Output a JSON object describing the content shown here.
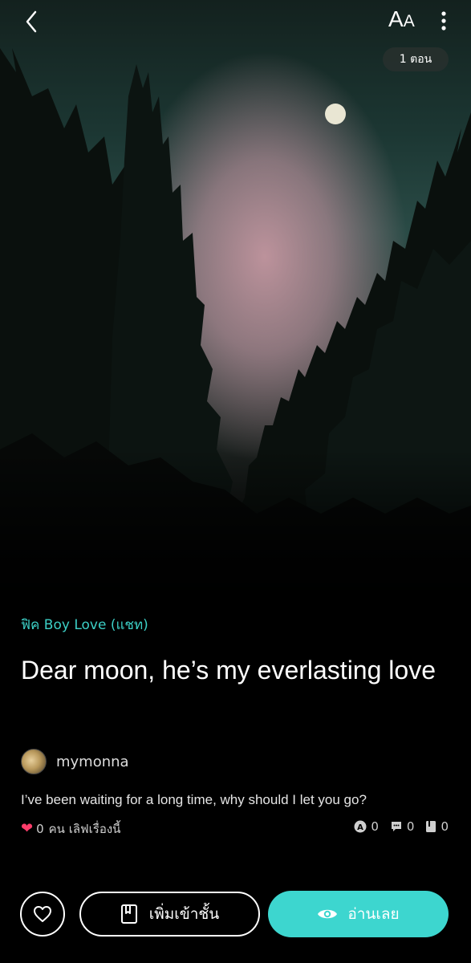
{
  "header": {
    "font_size_label": {
      "big": "A",
      "small": "A"
    },
    "episodes_badge": "1 ตอน"
  },
  "story": {
    "genre": "ฟิค Boy Love (แชท)",
    "title": "Dear moon, he’s my everlasting love",
    "author": "mymonna",
    "description": "I’ve been waiting for a long time, why should I let you go?",
    "love_count": "0",
    "love_text": "คน เลิฟเรื่องนี้",
    "stats": {
      "views": "0",
      "comments": "0",
      "shelf": "0"
    }
  },
  "actions": {
    "add_to_shelf_label": "เพิ่มเข้าชั้น",
    "read_now_label": "อ่านเลย"
  },
  "colors": {
    "accent": "#3dd6cf",
    "genre_text": "#3ccfc6",
    "heart": "#ff3d6b",
    "background": "#000000"
  },
  "icons": [
    "back-icon",
    "font-size-icon",
    "more-vert-icon",
    "heart-icon",
    "views-icon",
    "comment-icon",
    "shelf-icon",
    "bookmark-book-icon",
    "eye-icon"
  ]
}
